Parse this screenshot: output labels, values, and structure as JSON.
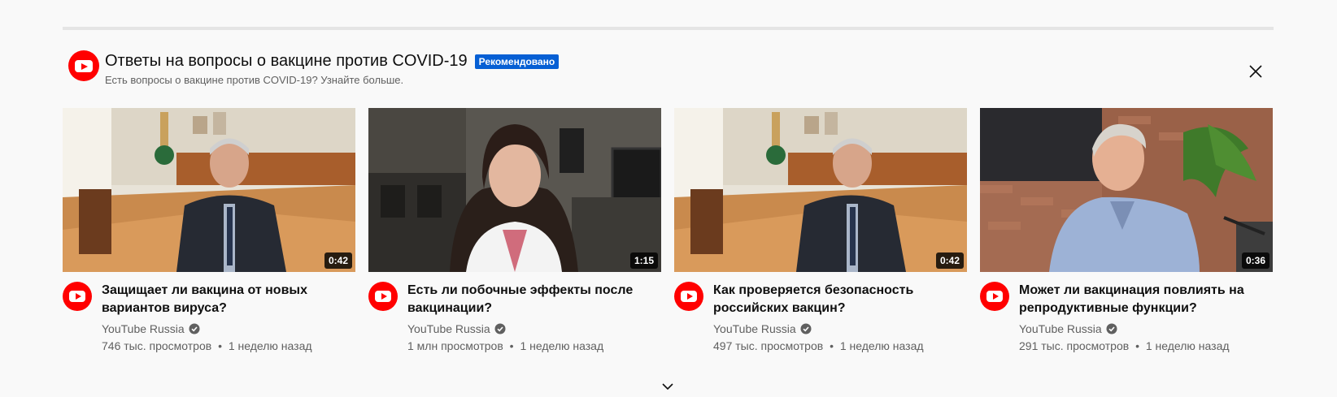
{
  "shelf": {
    "title": "Ответы на вопросы о вакцине против COVID-19",
    "badge": "Рекомендовано",
    "subtitle": "Есть вопросы о вакцине против COVID-19? Узнайте больше."
  },
  "videos": [
    {
      "title": "Защищает ли вакцина от новых вариантов вируса?",
      "channel": "YouTube Russia",
      "views": "746 тыс. просмотров",
      "separator": "•",
      "age": "1 неделю назад",
      "duration": "0:42"
    },
    {
      "title": "Есть ли побочные эффекты после вакцинации?",
      "channel": "YouTube Russia",
      "views": "1 млн просмотров",
      "separator": "•",
      "age": "1 неделю назад",
      "duration": "1:15"
    },
    {
      "title": "Как проверяется безопасность российских вакцин?",
      "channel": "YouTube Russia",
      "views": "497 тыс. просмотров",
      "separator": "•",
      "age": "1 неделю назад",
      "duration": "0:42"
    },
    {
      "title": "Может ли вакцинация повлиять на репродуктивные функции?",
      "channel": "YouTube Russia",
      "views": "291 тыс. просмотров",
      "separator": "•",
      "age": "1 неделю назад",
      "duration": "0:36"
    }
  ],
  "icons": {
    "shelf_logo": "youtube-logo-icon",
    "close": "close-icon",
    "verified": "verified-check-icon",
    "expand": "chevron-down-icon"
  },
  "colors": {
    "brand_red": "#ff0000",
    "badge_blue": "#065fd4",
    "secondary_text": "#606060",
    "background": "#f9f9f9"
  }
}
